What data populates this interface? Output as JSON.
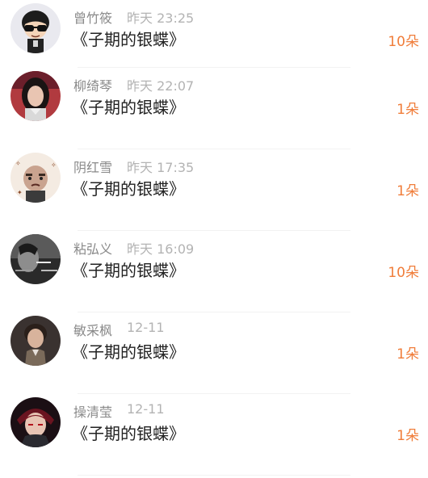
{
  "records": [
    {
      "name": "曾竹筱",
      "time": "昨天 23:25",
      "gift": "《子期的银蝶》",
      "count": "10朵",
      "avatar": "cartoon-boy-sunglasses-avatar"
    },
    {
      "name": "柳绮琴",
      "time": "昨天 22:07",
      "gift": "《子期的银蝶》",
      "count": "1朵",
      "avatar": "girl-portrait-avatar"
    },
    {
      "name": "阴红雪",
      "time": "昨天 17:35",
      "gift": "《子期的银蝶》",
      "count": "1朵",
      "avatar": "angry-baby-meme-avatar"
    },
    {
      "name": "粘弘义",
      "time": "昨天 16:09",
      "gift": "《子期的银蝶》",
      "count": "10朵",
      "avatar": "smoking-man-bw-avatar"
    },
    {
      "name": "敏采枫",
      "time": "12-11",
      "gift": "《子期的银蝶》",
      "count": "1朵",
      "avatar": "man-portrait-avatar"
    },
    {
      "name": "操清莹",
      "time": "12-11",
      "gift": "《子期的银蝶》",
      "count": "1朵",
      "avatar": "anime-character-avatar"
    }
  ],
  "colors": {
    "name": "#8a8a8a",
    "time": "#b3b3b3",
    "gift": "#222222",
    "count": "#f07d3a"
  }
}
